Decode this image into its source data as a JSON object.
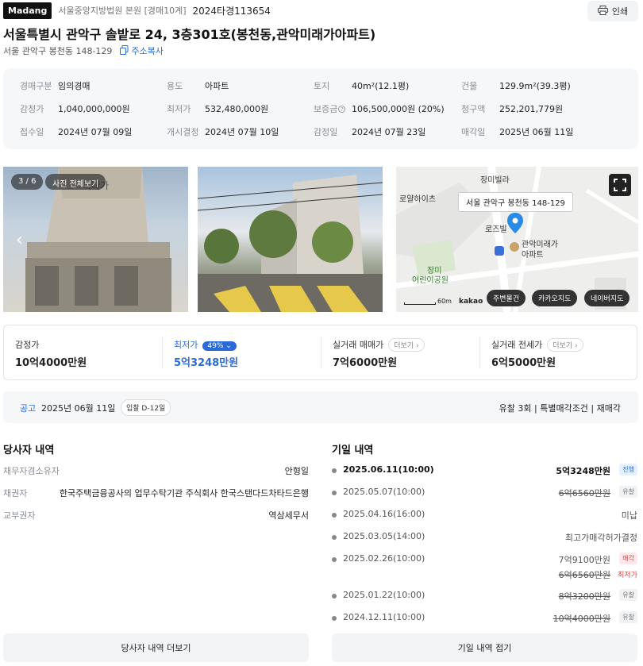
{
  "header": {
    "logo": "Madang",
    "court": "서울중앙지방법원 본원 [경매10계]",
    "case_number": "2024타경113654",
    "print_label": "인쇄"
  },
  "property": {
    "title": "서울특별시 관악구 솔밭로 24, 3층301호(봉천동,관악미래가아파트)",
    "short_address": "서울 관악구 봉천동 148-129",
    "copy_label": "주소복사"
  },
  "summary": [
    [
      {
        "label": "경매구분",
        "value": "임의경매"
      },
      {
        "label": "용도",
        "value": "아파트"
      },
      {
        "label": "토지",
        "value": "40m²(12.1평)"
      },
      {
        "label": "건물",
        "value": "129.9m²(39.3평)"
      }
    ],
    [
      {
        "label": "감정가",
        "value": "1,040,000,000원"
      },
      {
        "label": "최저가",
        "value": "532,480,000원"
      },
      {
        "label": "보증금",
        "value": "106,500,000원 (20%)"
      },
      {
        "label": "청구액",
        "value": "252,201,779원"
      }
    ],
    [
      {
        "label": "접수일",
        "value": "2024년 07월 09일"
      },
      {
        "label": "개시결정",
        "value": "2024년 07월 10일"
      },
      {
        "label": "감정일",
        "value": "2024년 07월 23일"
      },
      {
        "label": "매각일",
        "value": "2025년 06월 11일"
      }
    ]
  ],
  "photos": {
    "counter": "3 / 6",
    "view_all": "사진 전체보기"
  },
  "map": {
    "tooltip": "서울 관악구 봉천동 148-129",
    "labels": [
      "장미빌라",
      "로얄하이츠",
      "로즈빌",
      "관악미래가",
      "아파트",
      "장미",
      "어린이공원",
      "kakao",
      "60m"
    ],
    "buttons": [
      "주변물건",
      "카카오지도",
      "네이버지도"
    ]
  },
  "prices": [
    {
      "label": "감정가",
      "value": "10억4000만원"
    },
    {
      "label": "최저가",
      "value": "5억3248만원",
      "badge": "49%"
    },
    {
      "label": "실거래 매매가",
      "value": "7억6000만원",
      "more": "더보기"
    },
    {
      "label": "실거래 전세가",
      "value": "6억5000만원",
      "more": "더보기"
    }
  ],
  "notice": {
    "tag": "공고",
    "date": "2025년 06월 11일",
    "dday": "입찰 D-12일",
    "right": "유찰 3회  |  특별매각조건  |  재매각"
  },
  "parties": {
    "title": "당사자 내역",
    "rows": [
      {
        "label": "채무자겸소유자",
        "value": "안형일"
      },
      {
        "label": "채권자",
        "value": "한국주택금융공사의 업무수탁기관 주식회사 한국스탠다드차타드은행"
      },
      {
        "label": "교부권자",
        "value": "역삼세무서"
      }
    ],
    "more_button": "당사자 내역 더보기"
  },
  "history": {
    "title": "기일 내역",
    "rows": [
      {
        "date": "2025.06.11(10:00)",
        "value": "5억3248만원",
        "tag": "진행"
      },
      {
        "date": "2025.05.07(10:00)",
        "value": "6억6560만원",
        "tag": "유찰"
      },
      {
        "date": "2025.04.16(16:00)",
        "value": "미납"
      },
      {
        "date": "2025.03.05(14:00)",
        "value": "최고가매각허가결정"
      },
      {
        "date": "2025.02.26(10:00)",
        "value": "7억9100만원",
        "tag": "매각",
        "sub_value": "6억6560만원",
        "sub_tag": "최저가"
      },
      {
        "date": "2025.01.22(10:00)",
        "value": "8억3200만원",
        "tag": "유찰"
      },
      {
        "date": "2024.12.11(10:00)",
        "value": "10억4000만원",
        "tag": "유찰"
      }
    ],
    "collapse_button": "기일 내역 접기"
  }
}
